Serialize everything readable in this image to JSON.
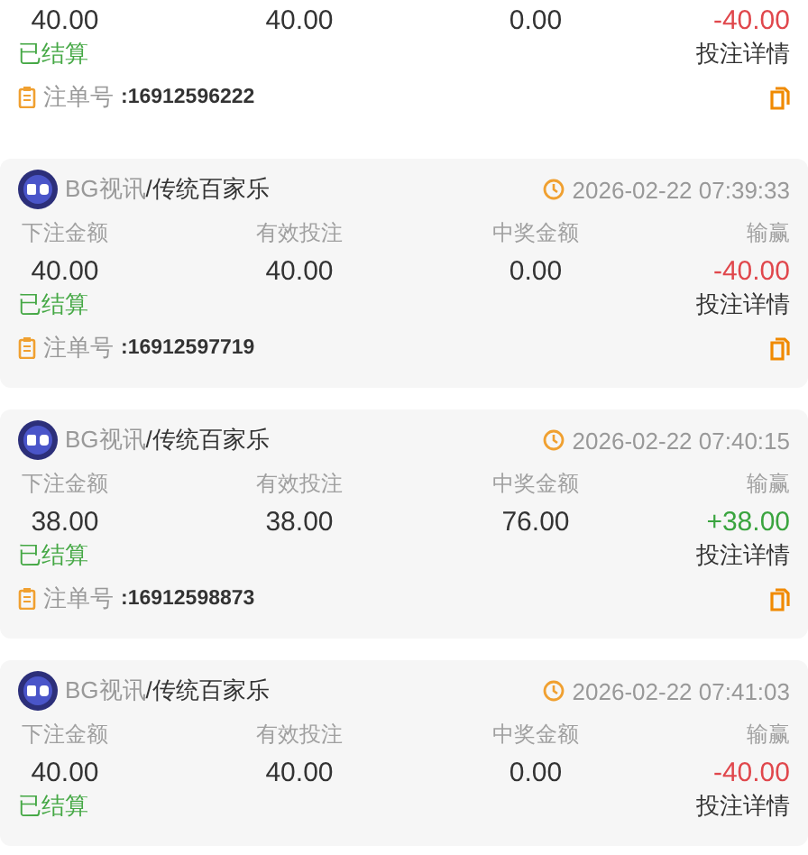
{
  "bets": [
    {
      "values": [
        "40.00",
        "40.00",
        "0.00",
        "-40.00"
      ],
      "color": "#e0474c",
      "status": "已结算",
      "detail_link": "投注详情",
      "order_label": "注单号",
      "order_no": ":16912596222"
    },
    {
      "provider": "BG视讯",
      "game": "/传统百家乐",
      "time": "2026-02-22 07:39:33",
      "labels": [
        "下注金额",
        "有效投注",
        "中奖金额",
        "输赢"
      ],
      "values": [
        "40.00",
        "40.00",
        "0.00",
        "-40.00"
      ],
      "color": "#e0474c",
      "status": "已结算",
      "detail_link": "投注详情",
      "order_label": "注单号",
      "order_no": ":16912597719"
    },
    {
      "provider": "BG视讯",
      "game": "/传统百家乐",
      "time": "2026-02-22 07:40:15",
      "labels": [
        "下注金额",
        "有效投注",
        "中奖金额",
        "输赢"
      ],
      "values": [
        "38.00",
        "38.00",
        "76.00",
        "+38.00"
      ],
      "color": "#3aa43f",
      "status": "已结算",
      "detail_link": "投注详情",
      "order_label": "注单号",
      "order_no": ":16912598873"
    },
    {
      "provider": "BG视讯",
      "game": "/传统百家乐",
      "time": "2026-02-22 07:41:03",
      "labels": [
        "下注金额",
        "有效投注",
        "中奖金额",
        "输赢"
      ],
      "values": [
        "40.00",
        "40.00",
        "0.00",
        "-40.00"
      ],
      "color": "#e0474c",
      "status": "已结算",
      "detail_link": "投注详情"
    }
  ]
}
